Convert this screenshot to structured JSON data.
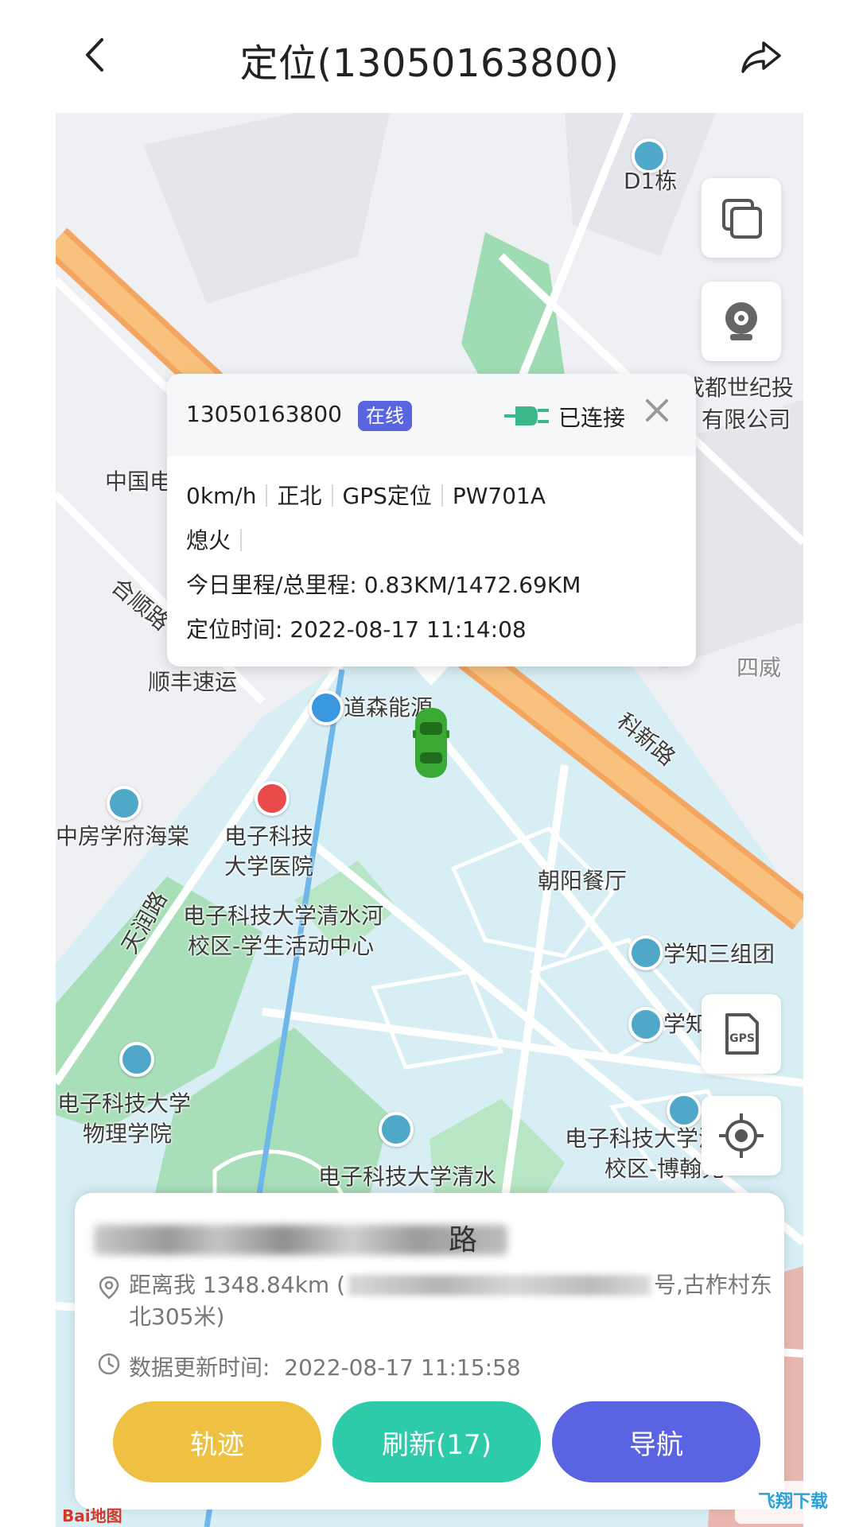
{
  "header": {
    "title": "定位(13050163800)"
  },
  "map": {
    "labels": {
      "d1": "D1栋",
      "cdsj": "成都世纪投",
      "youxian": "有限公司",
      "zhongguo": "中国电",
      "heshun": "合顺路",
      "shunfeng": "顺丰速运",
      "daosen": "道森能源",
      "kexin": "科新路",
      "siwei": "四威",
      "fangfu": "中房学府海棠",
      "hospital1": "电子科技",
      "hospital2": "大学医院",
      "chaoyang": "朝阳餐厅",
      "tianrun": "天润路",
      "qingshui1": "电子科技大学清水河",
      "qingshui2": "校区-学生活动中心",
      "xuezhi1": "学知三组团",
      "xuezhi2": "学知四组团",
      "physics1": "电子科技大学",
      "physics2": "物理学院",
      "qingshui3": "电子科技大学清水",
      "bohan1": "电子科技大学清水河",
      "bohan2": "校区-博翰苑"
    }
  },
  "popup": {
    "device_id": "13050163800",
    "status_badge": "在线",
    "connection_status": "已连接",
    "speed": "0km/h",
    "direction": "正北",
    "location_mode": "GPS定位",
    "model": "PW701A",
    "ignition": "熄火",
    "mileage_label": "今日里程/总里程:",
    "mileage_value": "0.83KM/1472.69KM",
    "time_label": "定位时间:",
    "time_value": "2022-08-17 11:14:08"
  },
  "bottom_panel": {
    "address_tail": "路",
    "distance_prefix": "距离我 1348.84km (",
    "distance_suffix": "号,古柞村东北305米)",
    "update_label": "数据更新时间:",
    "update_value": "2022-08-17 11:15:58"
  },
  "actions": {
    "track": "轨迹",
    "refresh": "刷新(17)",
    "navigate": "导航"
  },
  "map_controls": {
    "gps_label": "GPS"
  },
  "footer": {
    "baidu_logo": "Bai地图",
    "watermark": "飞翔下载"
  },
  "colors": {
    "online_badge": "#5864e0",
    "track_button": "#efc142",
    "refresh_button": "#2dcba9",
    "navigate_button": "#5a64e2",
    "car": "#3aaa35",
    "road_major": "#f6a964"
  }
}
